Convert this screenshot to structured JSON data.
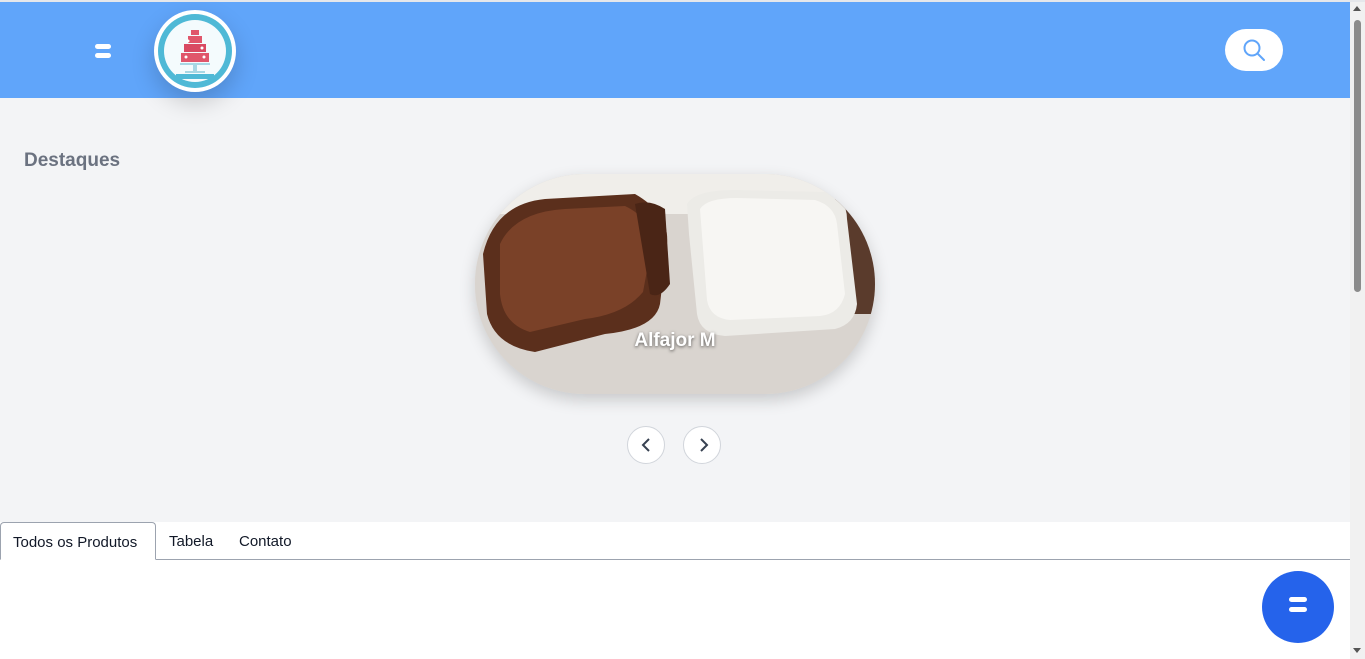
{
  "header": {
    "menu_icon": "hamburger-icon",
    "logo_icon": "cake-stand-logo",
    "search_icon": "search-icon",
    "background_color": "#60a5fa"
  },
  "highlights": {
    "title": "Destaques",
    "slide_caption": "Alfajor M",
    "prev_icon": "chevron-left-icon",
    "next_icon": "chevron-right-icon"
  },
  "tabs": [
    {
      "label": "Todos os Produtos",
      "active": true
    },
    {
      "label": "Tabela",
      "active": false
    },
    {
      "label": "Contato",
      "active": false
    }
  ],
  "fab": {
    "icon": "hamburger-icon",
    "color": "#2563eb"
  }
}
